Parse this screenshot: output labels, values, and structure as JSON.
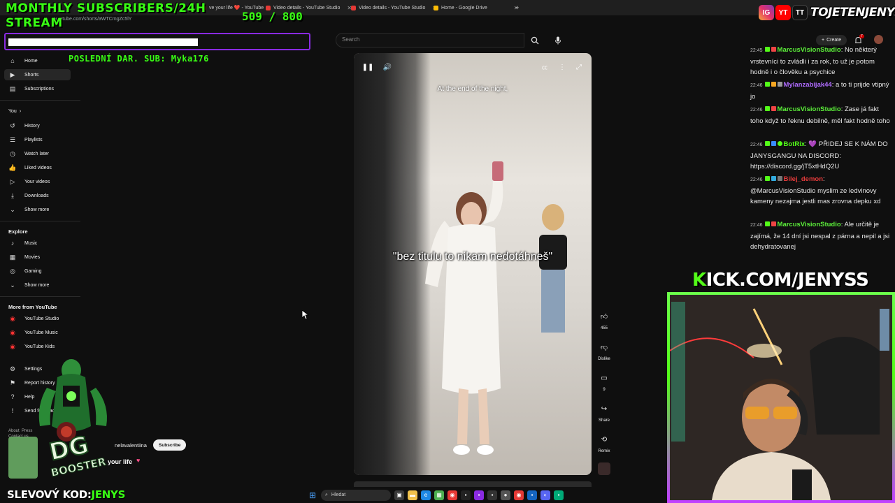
{
  "browser": {
    "url": "youtube.com/shorts/aWTCmgZc5lY",
    "tabs": [
      {
        "label": "ve your life ❤️ - YouTube"
      },
      {
        "label": "Video details - YouTube Studio"
      },
      {
        "label": "Video details - YouTube Studio"
      },
      {
        "label": "Home - Google Drive"
      }
    ],
    "new_tab": "+"
  },
  "overlay": {
    "title_line1": "MONTHLY SUBSCRIBERS/24H",
    "title_line2": "STREAM",
    "sub_count": "509 / 800",
    "goal_fraction": 0.636,
    "last_donation": "POSLEDNÍ DAR. SUB: Myka176",
    "kick_k": "K",
    "kick_rest": "ICK.COM/JENYSS",
    "handle": "TOJETENJENYS",
    "discount_label": "SLEVOVÝ KOD:",
    "discount_code": "JENYS",
    "social": [
      "IG",
      "YT",
      "TT"
    ]
  },
  "header": {
    "search_placeholder": "Search",
    "create_label": "Create",
    "notif_count": "7"
  },
  "sidebar": {
    "items_top": [
      {
        "label": "Home",
        "icon": "home-icon"
      },
      {
        "label": "Shorts",
        "icon": "shorts-icon"
      },
      {
        "label": "Subscriptions",
        "icon": "subscriptions-icon"
      }
    ],
    "you_label": "You",
    "you_items": [
      {
        "label": "History"
      },
      {
        "label": "Playlists"
      },
      {
        "label": "Watch later"
      },
      {
        "label": "Liked videos"
      },
      {
        "label": "Your videos"
      },
      {
        "label": "Downloads"
      },
      {
        "label": "Show more"
      }
    ],
    "explore_label": "Explore",
    "explore_items": [
      {
        "label": "Music"
      },
      {
        "label": "Movies"
      },
      {
        "label": "Gaming"
      },
      {
        "label": "Show more"
      }
    ],
    "more_label": "More from YouTube",
    "more_items": [
      {
        "label": "YouTube Studio"
      },
      {
        "label": "YouTube Music"
      },
      {
        "label": "YouTube Kids"
      }
    ],
    "bottom_items": [
      {
        "label": "Settings"
      },
      {
        "label": "Report history"
      },
      {
        "label": "Help"
      },
      {
        "label": "Send feedback"
      }
    ],
    "footer": "About  Press\nContact us"
  },
  "video": {
    "caption_top": "At the end of the night,",
    "caption_mid": "\"bez titulu to nikam nedotáhneš\"",
    "channel": "nelavalentiina",
    "subscribe_label": "Subscribe",
    "description": "your life",
    "actions": [
      {
        "label": "455",
        "icon": "like-icon"
      },
      {
        "label": "Dislike",
        "icon": "dislike-icon"
      },
      {
        "label": "9",
        "icon": "comment-icon"
      },
      {
        "label": "Share",
        "icon": "share-icon"
      },
      {
        "label": "Remix",
        "icon": "remix-icon"
      }
    ]
  },
  "chat": [
    {
      "time": "22:45",
      "user": "MarcusVisionStudio",
      "color": "#5cf03a",
      "msg": ": No některý vrstevníci to zvládli i za rok, to už je potom hodně i o člověku a psychice"
    },
    {
      "time": "22:46",
      "user": "Mylanzabijak44",
      "color": "#b06cff",
      "msg": ": a to ti prijde vtipný jo"
    },
    {
      "time": "22:46",
      "user": "MarcusVisionStudio",
      "color": "#5cf03a",
      "msg": ": Zase já fakt toho když to řeknu debilně, měl fakt hodně toho"
    },
    {
      "time": "22:46",
      "user": "BotRix",
      "color": "#53fc18",
      "msg": ": 💜 PŘIDEJ SE K NÁM DO JANYSGANGU NA DISCORD: https://discord.gg/jT5xtHdQ2U"
    },
    {
      "time": "22:46",
      "user": "Bilej_demon",
      "color": "#e33b3b",
      "msg": ": @MarcusVisionStudio myslim ze ledvinovy kameny nezajma jestli mas zrovna depku xd"
    },
    {
      "time": "22:46",
      "user": "MarcusVisionStudio",
      "color": "#5cf03a",
      "msg": ": Ale určitě je zajímá, že 14 dní jsi nespal z párna a nepil a jsi dehydratovanej"
    }
  ],
  "taskbar": {
    "search_label": "Hledat"
  }
}
